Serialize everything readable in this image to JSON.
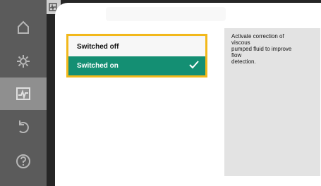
{
  "menu": {
    "options": [
      {
        "label": "Switched off",
        "selected": false
      },
      {
        "label": "Switched on",
        "selected": true
      }
    ]
  },
  "info": {
    "text": "Activate correction of\nviscous\npumped fluid to improve\nflow\ndetection."
  },
  "sidebar": {
    "items": [
      {
        "icon": "home-icon"
      },
      {
        "icon": "gear-icon"
      },
      {
        "icon": "monitor-icon",
        "active": true
      },
      {
        "icon": "undo-icon"
      },
      {
        "icon": "help-icon"
      }
    ]
  },
  "colors": {
    "accent": "#148f73",
    "focus": "#f2b81b",
    "sidebar": "#5b5b5b",
    "active": "#8f8f8f",
    "info_bg": "#e3e3e3"
  }
}
